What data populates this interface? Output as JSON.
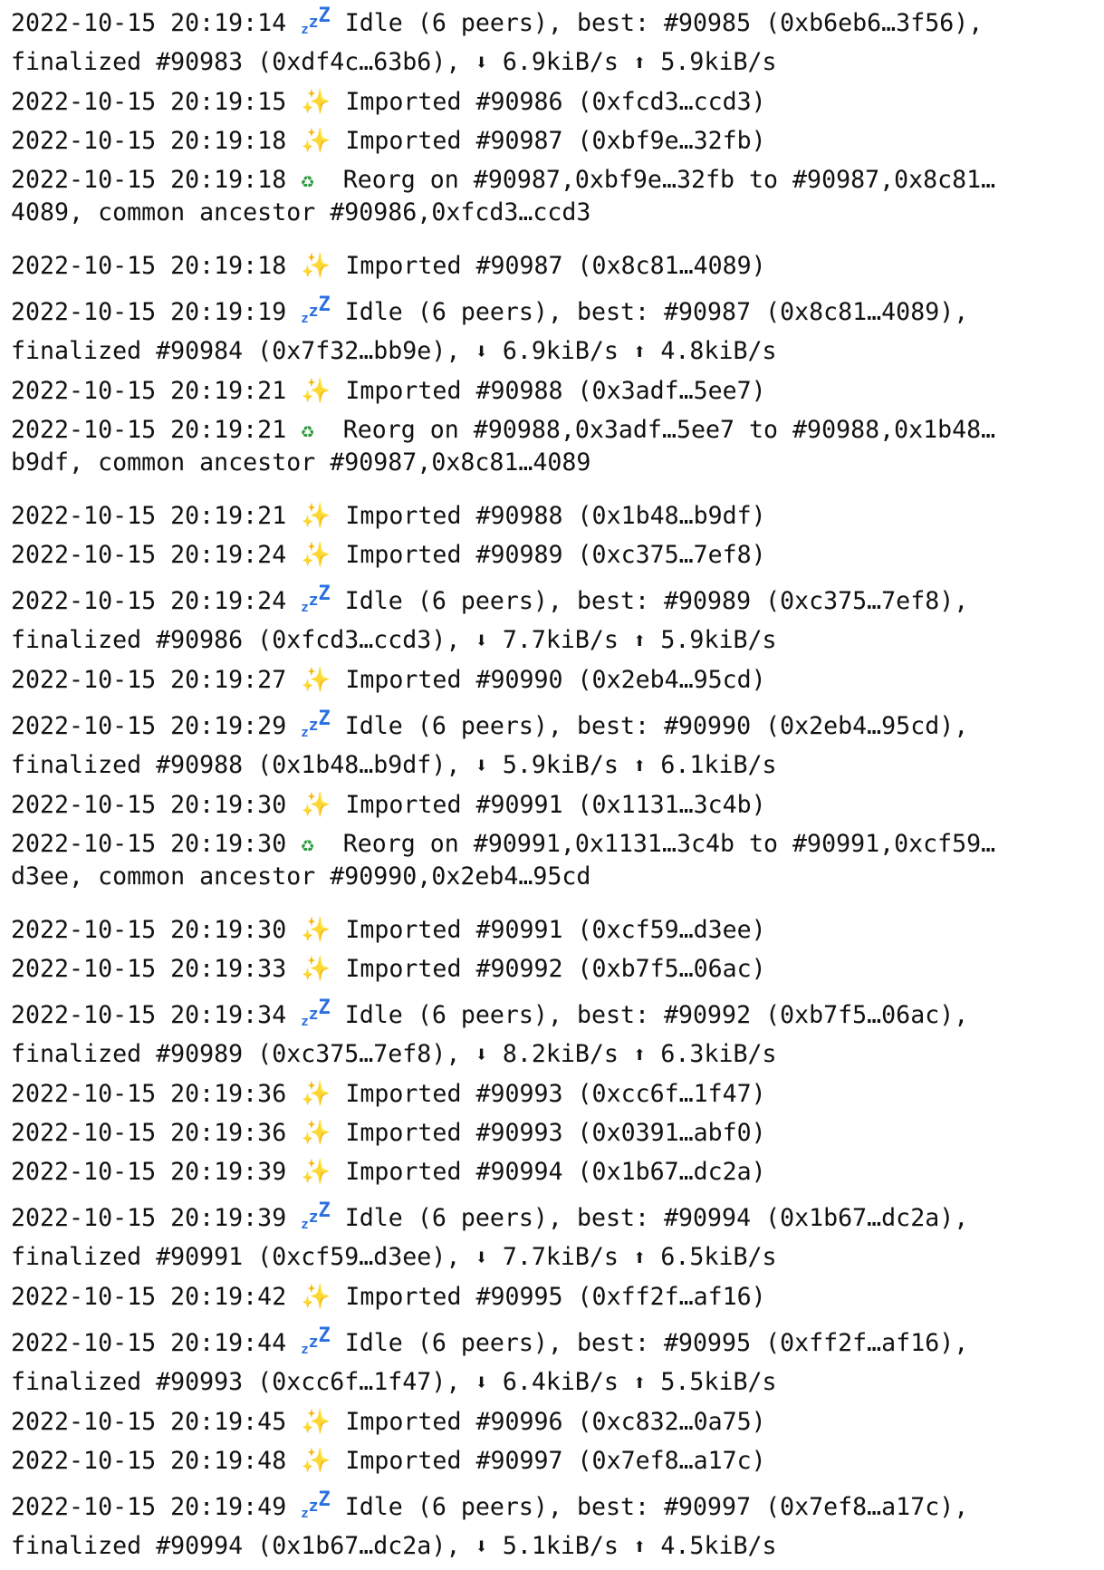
{
  "log": {
    "entries": [
      {
        "ts": "2022-10-15 20:19:14",
        "kind": "idle",
        "line1": " Idle (6 peers), best: #90985 (0xb6eb6…3f56),",
        "line2": "finalized #90983 (0xdf4c…63b6), ",
        "down": "6.9kiB/s",
        "up": "5.9kiB/s"
      },
      {
        "ts": "2022-10-15 20:19:15",
        "kind": "imported",
        "text": " Imported #90986 (0xfcd3…ccd3)"
      },
      {
        "ts": "2022-10-15 20:19:18",
        "kind": "imported",
        "text": " Imported #90987 (0xbf9e…32fb)"
      },
      {
        "ts": "2022-10-15 20:19:18",
        "kind": "reorg",
        "line1": "  Reorg on #90987,0xbf9e…32fb to #90987,0x8c81…",
        "line2": "4089, common ancestor #90986,0xfcd3…ccd3"
      },
      {
        "ts": "2022-10-15 20:19:18",
        "kind": "imported",
        "text": " Imported #90987 (0x8c81…4089)"
      },
      {
        "ts": "2022-10-15 20:19:19",
        "kind": "idle",
        "line1": " Idle (6 peers), best: #90987 (0x8c81…4089),",
        "line2": "finalized #90984 (0x7f32…bb9e), ",
        "down": "6.9kiB/s",
        "up": "4.8kiB/s"
      },
      {
        "ts": "2022-10-15 20:19:21",
        "kind": "imported",
        "text": " Imported #90988 (0x3adf…5ee7)"
      },
      {
        "ts": "2022-10-15 20:19:21",
        "kind": "reorg",
        "line1": "  Reorg on #90988,0x3adf…5ee7 to #90988,0x1b48…",
        "line2": "b9df, common ancestor #90987,0x8c81…4089"
      },
      {
        "ts": "2022-10-15 20:19:21",
        "kind": "imported",
        "text": " Imported #90988 (0x1b48…b9df)"
      },
      {
        "ts": "2022-10-15 20:19:24",
        "kind": "imported",
        "text": " Imported #90989 (0xc375…7ef8)"
      },
      {
        "ts": "2022-10-15 20:19:24",
        "kind": "idle",
        "line1": " Idle (6 peers), best: #90989 (0xc375…7ef8),",
        "line2": "finalized #90986 (0xfcd3…ccd3), ",
        "down": "7.7kiB/s",
        "up": "5.9kiB/s"
      },
      {
        "ts": "2022-10-15 20:19:27",
        "kind": "imported",
        "text": " Imported #90990 (0x2eb4…95cd)"
      },
      {
        "ts": "2022-10-15 20:19:29",
        "kind": "idle",
        "line1": " Idle (6 peers), best: #90990 (0x2eb4…95cd),",
        "line2": "finalized #90988 (0x1b48…b9df), ",
        "down": "5.9kiB/s",
        "up": "6.1kiB/s"
      },
      {
        "ts": "2022-10-15 20:19:30",
        "kind": "imported",
        "text": " Imported #90991 (0x1131…3c4b)"
      },
      {
        "ts": "2022-10-15 20:19:30",
        "kind": "reorg",
        "line1": "  Reorg on #90991,0x1131…3c4b to #90991,0xcf59…",
        "line2": "d3ee, common ancestor #90990,0x2eb4…95cd"
      },
      {
        "ts": "2022-10-15 20:19:30",
        "kind": "imported",
        "text": " Imported #90991 (0xcf59…d3ee)"
      },
      {
        "ts": "2022-10-15 20:19:33",
        "kind": "imported",
        "text": " Imported #90992 (0xb7f5…06ac)"
      },
      {
        "ts": "2022-10-15 20:19:34",
        "kind": "idle",
        "line1": " Idle (6 peers), best: #90992 (0xb7f5…06ac),",
        "line2": "finalized #90989 (0xc375…7ef8), ",
        "down": "8.2kiB/s",
        "up": "6.3kiB/s"
      },
      {
        "ts": "2022-10-15 20:19:36",
        "kind": "imported",
        "text": " Imported #90993 (0xcc6f…1f47)"
      },
      {
        "ts": "2022-10-15 20:19:36",
        "kind": "imported",
        "text": " Imported #90993 (0x0391…abf0)"
      },
      {
        "ts": "2022-10-15 20:19:39",
        "kind": "imported",
        "text": " Imported #90994 (0x1b67…dc2a)"
      },
      {
        "ts": "2022-10-15 20:19:39",
        "kind": "idle",
        "line1": " Idle (6 peers), best: #90994 (0x1b67…dc2a),",
        "line2": "finalized #90991 (0xcf59…d3ee), ",
        "down": "7.7kiB/s",
        "up": "6.5kiB/s"
      },
      {
        "ts": "2022-10-15 20:19:42",
        "kind": "imported",
        "text": " Imported #90995 (0xff2f…af16)"
      },
      {
        "ts": "2022-10-15 20:19:44",
        "kind": "idle",
        "line1": " Idle (6 peers), best: #90995 (0xff2f…af16),",
        "line2": "finalized #90993 (0xcc6f…1f47), ",
        "down": "6.4kiB/s",
        "up": "5.5kiB/s"
      },
      {
        "ts": "2022-10-15 20:19:45",
        "kind": "imported",
        "text": " Imported #90996 (0xc832…0a75)"
      },
      {
        "ts": "2022-10-15 20:19:48",
        "kind": "imported",
        "text": " Imported #90997 (0x7ef8…a17c)"
      },
      {
        "ts": "2022-10-15 20:19:49",
        "kind": "idle",
        "line1": " Idle (6 peers), best: #90997 (0x7ef8…a17c),",
        "line2": "finalized #90994 (0x1b67…dc2a), ",
        "down": "5.1kiB/s",
        "up": "4.5kiB/s"
      }
    ]
  },
  "icons": {
    "imported": "sparkles-icon",
    "reorg": "recycle-icon",
    "idle": "sleeping-zzz-icon",
    "down": "down-arrow-icon",
    "up": "up-arrow-icon"
  },
  "colors": {
    "text": "#111111",
    "background": "#ffffff",
    "sparkle": "#f3c43a",
    "recycle": "#2e9b3c",
    "zzz": "#2a6fe0"
  }
}
